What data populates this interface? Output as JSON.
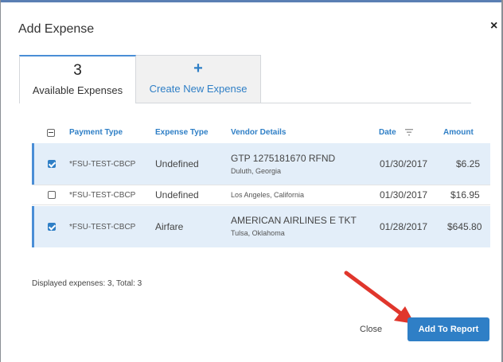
{
  "dialog": {
    "title": "Add Expense",
    "close_glyph": "×"
  },
  "tabs": [
    {
      "count": "3",
      "label": "Available Expenses",
      "active": true
    },
    {
      "icon": "plus-icon",
      "label": "Create New Expense",
      "active": false
    }
  ],
  "table": {
    "columns": [
      "Payment Type",
      "Expense Type",
      "Vendor Details",
      "Date",
      "Amount"
    ],
    "rows": [
      {
        "checked": true,
        "payment_type": "*FSU-TEST-CBCP",
        "expense_type": "Undefined",
        "vendor_name": "GTP 1275181670 RFND",
        "vendor_location": "Duluth, Georgia",
        "date": "01/30/2017",
        "amount": "$6.25"
      },
      {
        "checked": false,
        "payment_type": "*FSU-TEST-CBCP",
        "expense_type": "Undefined",
        "vendor_name": "",
        "vendor_location": "Los Angeles, California",
        "date": "01/30/2017",
        "amount": "$16.95"
      },
      {
        "checked": true,
        "payment_type": "*FSU-TEST-CBCP",
        "expense_type": "Airfare",
        "vendor_name": "AMERICAN AIRLINES E TKT",
        "vendor_location": "Tulsa, Oklahoma",
        "date": "01/28/2017",
        "amount": "$645.80"
      }
    ]
  },
  "summary": "Displayed expenses: 3, Total: 3",
  "footer": {
    "close_label": "Close",
    "add_label": "Add To Report"
  },
  "colors": {
    "accent": "#2f7fc6",
    "selected_row": "#e3eef9",
    "annotation_arrow": "#e0362c"
  }
}
